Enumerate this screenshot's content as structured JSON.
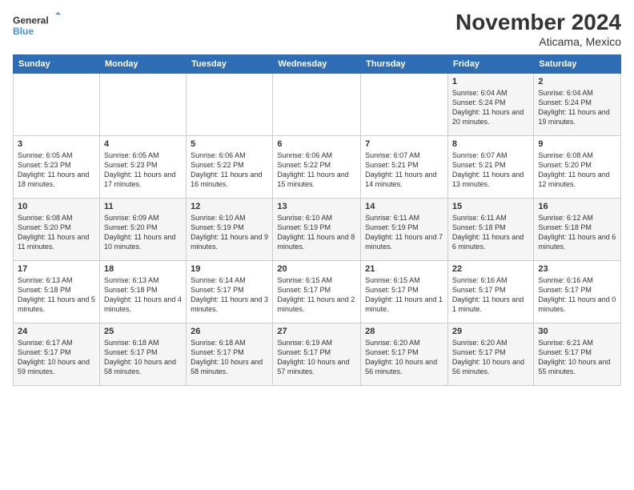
{
  "logo": {
    "line1": "General",
    "line2": "Blue"
  },
  "title": "November 2024",
  "subtitle": "Aticama, Mexico",
  "days_of_week": [
    "Sunday",
    "Monday",
    "Tuesday",
    "Wednesday",
    "Thursday",
    "Friday",
    "Saturday"
  ],
  "weeks": [
    [
      {
        "day": "",
        "detail": ""
      },
      {
        "day": "",
        "detail": ""
      },
      {
        "day": "",
        "detail": ""
      },
      {
        "day": "",
        "detail": ""
      },
      {
        "day": "",
        "detail": ""
      },
      {
        "day": "1",
        "detail": "Sunrise: 6:04 AM\nSunset: 5:24 PM\nDaylight: 11 hours and 20 minutes."
      },
      {
        "day": "2",
        "detail": "Sunrise: 6:04 AM\nSunset: 5:24 PM\nDaylight: 11 hours and 19 minutes."
      }
    ],
    [
      {
        "day": "3",
        "detail": "Sunrise: 6:05 AM\nSunset: 5:23 PM\nDaylight: 11 hours and 18 minutes."
      },
      {
        "day": "4",
        "detail": "Sunrise: 6:05 AM\nSunset: 5:23 PM\nDaylight: 11 hours and 17 minutes."
      },
      {
        "day": "5",
        "detail": "Sunrise: 6:06 AM\nSunset: 5:22 PM\nDaylight: 11 hours and 16 minutes."
      },
      {
        "day": "6",
        "detail": "Sunrise: 6:06 AM\nSunset: 5:22 PM\nDaylight: 11 hours and 15 minutes."
      },
      {
        "day": "7",
        "detail": "Sunrise: 6:07 AM\nSunset: 5:21 PM\nDaylight: 11 hours and 14 minutes."
      },
      {
        "day": "8",
        "detail": "Sunrise: 6:07 AM\nSunset: 5:21 PM\nDaylight: 11 hours and 13 minutes."
      },
      {
        "day": "9",
        "detail": "Sunrise: 6:08 AM\nSunset: 5:20 PM\nDaylight: 11 hours and 12 minutes."
      }
    ],
    [
      {
        "day": "10",
        "detail": "Sunrise: 6:08 AM\nSunset: 5:20 PM\nDaylight: 11 hours and 11 minutes."
      },
      {
        "day": "11",
        "detail": "Sunrise: 6:09 AM\nSunset: 5:20 PM\nDaylight: 11 hours and 10 minutes."
      },
      {
        "day": "12",
        "detail": "Sunrise: 6:10 AM\nSunset: 5:19 PM\nDaylight: 11 hours and 9 minutes."
      },
      {
        "day": "13",
        "detail": "Sunrise: 6:10 AM\nSunset: 5:19 PM\nDaylight: 11 hours and 8 minutes."
      },
      {
        "day": "14",
        "detail": "Sunrise: 6:11 AM\nSunset: 5:19 PM\nDaylight: 11 hours and 7 minutes."
      },
      {
        "day": "15",
        "detail": "Sunrise: 6:11 AM\nSunset: 5:18 PM\nDaylight: 11 hours and 6 minutes."
      },
      {
        "day": "16",
        "detail": "Sunrise: 6:12 AM\nSunset: 5:18 PM\nDaylight: 11 hours and 6 minutes."
      }
    ],
    [
      {
        "day": "17",
        "detail": "Sunrise: 6:13 AM\nSunset: 5:18 PM\nDaylight: 11 hours and 5 minutes."
      },
      {
        "day": "18",
        "detail": "Sunrise: 6:13 AM\nSunset: 5:18 PM\nDaylight: 11 hours and 4 minutes."
      },
      {
        "day": "19",
        "detail": "Sunrise: 6:14 AM\nSunset: 5:17 PM\nDaylight: 11 hours and 3 minutes."
      },
      {
        "day": "20",
        "detail": "Sunrise: 6:15 AM\nSunset: 5:17 PM\nDaylight: 11 hours and 2 minutes."
      },
      {
        "day": "21",
        "detail": "Sunrise: 6:15 AM\nSunset: 5:17 PM\nDaylight: 11 hours and 1 minute."
      },
      {
        "day": "22",
        "detail": "Sunrise: 6:16 AM\nSunset: 5:17 PM\nDaylight: 11 hours and 1 minute."
      },
      {
        "day": "23",
        "detail": "Sunrise: 6:16 AM\nSunset: 5:17 PM\nDaylight: 11 hours and 0 minutes."
      }
    ],
    [
      {
        "day": "24",
        "detail": "Sunrise: 6:17 AM\nSunset: 5:17 PM\nDaylight: 10 hours and 59 minutes."
      },
      {
        "day": "25",
        "detail": "Sunrise: 6:18 AM\nSunset: 5:17 PM\nDaylight: 10 hours and 58 minutes."
      },
      {
        "day": "26",
        "detail": "Sunrise: 6:18 AM\nSunset: 5:17 PM\nDaylight: 10 hours and 58 minutes."
      },
      {
        "day": "27",
        "detail": "Sunrise: 6:19 AM\nSunset: 5:17 PM\nDaylight: 10 hours and 57 minutes."
      },
      {
        "day": "28",
        "detail": "Sunrise: 6:20 AM\nSunset: 5:17 PM\nDaylight: 10 hours and 56 minutes."
      },
      {
        "day": "29",
        "detail": "Sunrise: 6:20 AM\nSunset: 5:17 PM\nDaylight: 10 hours and 56 minutes."
      },
      {
        "day": "30",
        "detail": "Sunrise: 6:21 AM\nSunset: 5:17 PM\nDaylight: 10 hours and 55 minutes."
      }
    ]
  ]
}
